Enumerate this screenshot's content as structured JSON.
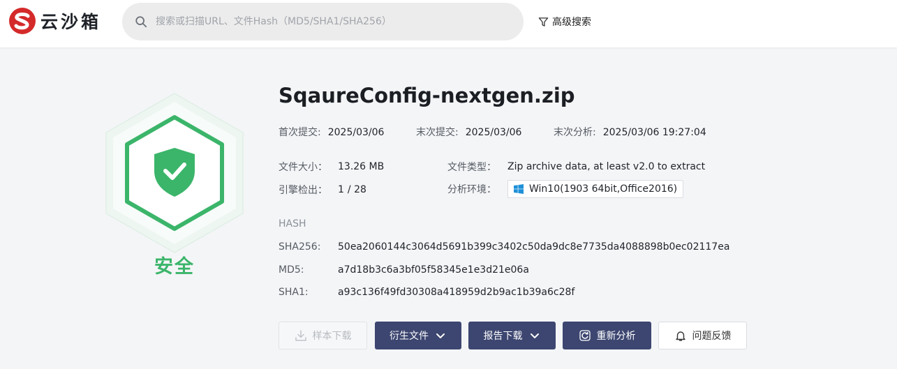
{
  "header": {
    "logo_text": "云沙箱",
    "search_placeholder": "搜索或扫描URL、文件Hash（MD5/SHA1/SHA256）",
    "advanced_search": "高级搜索"
  },
  "verdict": {
    "label": "安全",
    "color": "#3bb56a"
  },
  "file": {
    "name": "SqaureConfig-nextgen.zip",
    "first_submit_label": "首次提交:",
    "first_submit": "2025/03/06",
    "last_submit_label": "末次提交:",
    "last_submit": "2025/03/06",
    "last_analysis_label": "末次分析:",
    "last_analysis": "2025/03/06 19:27:04",
    "size_label": "文件大小：",
    "size": "13.26 MB",
    "type_label": "文件类型：",
    "type": "Zip archive data, at least v2.0 to extract",
    "engines_label": "引擎检出：",
    "engines_detected": "1",
    "engines_total": "/ 28",
    "env_label": "分析环境：",
    "env": "Win10(1903 64bit,Office2016)"
  },
  "hash": {
    "heading": "HASH",
    "rows": [
      {
        "label": "SHA256:",
        "value": "50ea2060144c3064d5691b399c3402c50da9dc8e7735da4088898b0ec02117ea"
      },
      {
        "label": "MD5:",
        "value": "a7d18b3c6a3bf05f58345e1e3d21e06a"
      },
      {
        "label": "SHA1:",
        "value": "a93c136f49fd30308a418959d2b9ac1b39a6c28f"
      }
    ]
  },
  "actions": {
    "sample_download": "样本下载",
    "derived_files": "衍生文件",
    "report_download": "报告下载",
    "reanalyze": "重新分析",
    "feedback": "问题反馈"
  },
  "colors": {
    "accent": "#3c4670",
    "safe": "#3bb56a",
    "brand_red": "#d42a2a",
    "alert_red": "#e0303a"
  },
  "icons": [
    "search-icon",
    "filter-icon",
    "shield-check-icon",
    "windows-icon",
    "download-icon",
    "chevron-down-icon",
    "refresh-icon",
    "bell-icon"
  ]
}
